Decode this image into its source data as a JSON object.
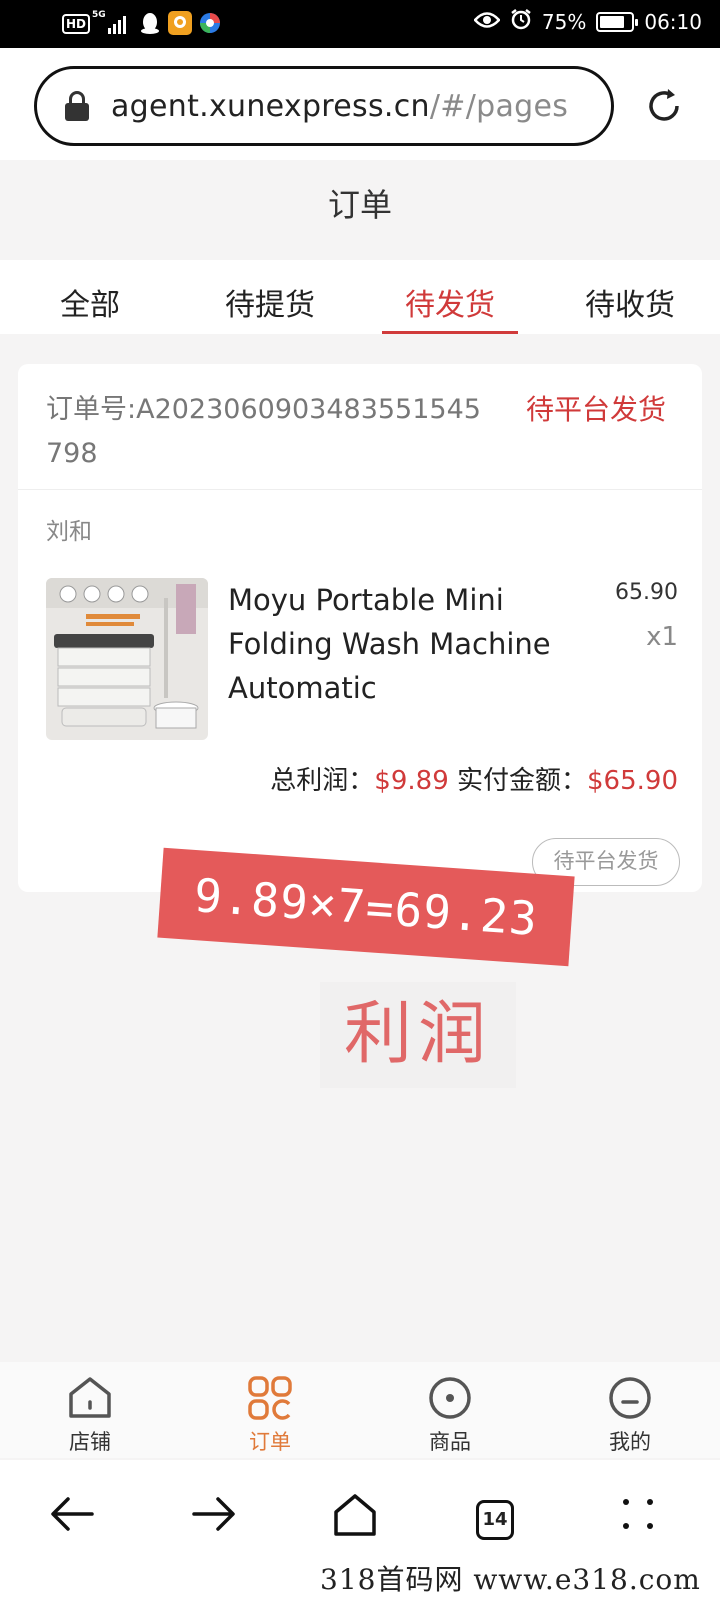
{
  "status_bar": {
    "network_badge": "HD",
    "network_type": "5G",
    "battery": "75%",
    "time": "06:10"
  },
  "browser": {
    "url_host": "agent.xunexpress.cn",
    "url_path": "/#/pages"
  },
  "page": {
    "title": "订单"
  },
  "tabs": [
    {
      "label": "全部",
      "active": false
    },
    {
      "label": "待提货",
      "active": false
    },
    {
      "label": "待发货",
      "active": true
    },
    {
      "label": "待收货",
      "active": false
    }
  ],
  "order": {
    "number_label": "订单号:A20230609034835515457 98",
    "number_text": "订单号:A2023060903483551545798",
    "status": "待平台发货",
    "customer": "刘和",
    "product": {
      "name": "Moyu Portable Mini Folding Wash Machine Automatic",
      "price": "65.90",
      "qty": "x1",
      "image_text_1": "Washing capacity",
      "image_text_2": "0.85KG can be washed"
    },
    "profit_label": "总利润：",
    "profit_value": "$9.89",
    "paid_label": "实付金额：",
    "paid_value": "$65.90",
    "status_button": "待平台发货"
  },
  "overlay": {
    "calculation": "9.89×7=69.23",
    "caption": "利润"
  },
  "bottom_nav": [
    {
      "label": "店铺",
      "icon": "home-icon",
      "active": false
    },
    {
      "label": "订单",
      "icon": "orders-grid-icon",
      "active": true
    },
    {
      "label": "商品",
      "icon": "circle-dot-icon",
      "active": false
    },
    {
      "label": "我的",
      "icon": "profile-icon",
      "active": false
    }
  ],
  "system_nav": {
    "tab_count": "14"
  },
  "watermark": "318首码网 www.e318.com",
  "colors": {
    "accent": "#d03a3a",
    "nav_active": "#e07a3a",
    "banner": "#e45a5a"
  }
}
